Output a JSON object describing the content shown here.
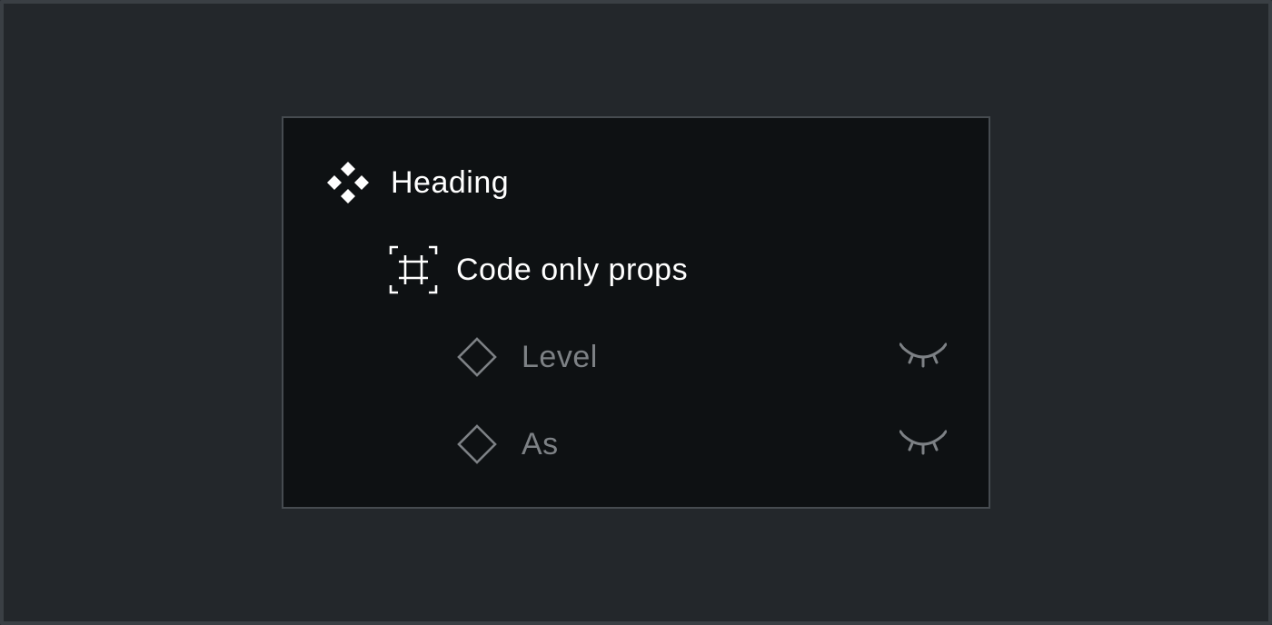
{
  "layers": {
    "heading": {
      "label": "Heading",
      "icon": "component-icon"
    },
    "frame": {
      "label": "Code only props",
      "icon": "frame-icon"
    },
    "props": [
      {
        "label": "Level",
        "icon": "instance-diamond-icon",
        "visibility_icon": "eye-closed-icon",
        "hidden": true
      },
      {
        "label": "As",
        "icon": "instance-diamond-icon",
        "visibility_icon": "eye-closed-icon",
        "hidden": true
      }
    ]
  },
  "colors": {
    "background": "#23272b",
    "panel": "#0e1113",
    "panel_border": "#464b50",
    "text_primary": "#ffffff",
    "text_muted": "#7d8185"
  }
}
